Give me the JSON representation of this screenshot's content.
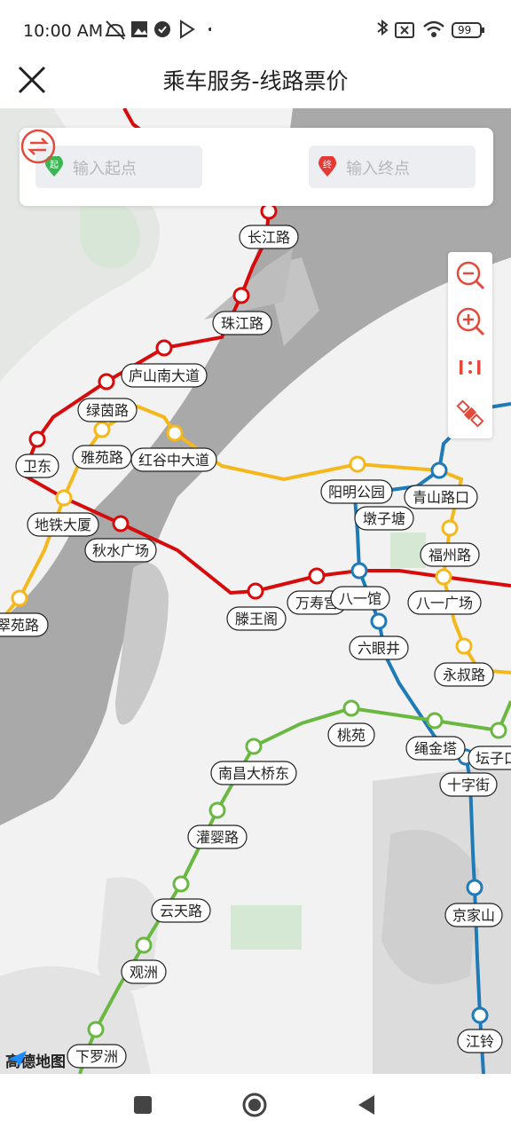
{
  "status_bar": {
    "time": "10:00 AM",
    "battery": "99"
  },
  "header": {
    "title": "乘车服务-线路票价"
  },
  "search": {
    "start_tag": "起",
    "end_tag": "终",
    "start_placeholder": "输入起点",
    "end_placeholder": "输入终点"
  },
  "map_controls": [
    "zoom-out",
    "zoom-in",
    "ratio-1-1",
    "satellite"
  ],
  "brand": {
    "logo_text": "高德地图"
  },
  "colors": {
    "line1_red": "#d60b0b",
    "line2_yellow": "#f5b81c",
    "line3_blue": "#1f7ab8",
    "line4_green": "#6ab842",
    "start_pin": "#3cb554",
    "end_pin": "#e53935",
    "accent": "#e24a3b"
  },
  "stations": {
    "changjiang": "长江路",
    "zhujiang": "珠江路",
    "lushan": "庐山南大道",
    "lvyin": "绿茵路",
    "weidong": "卫东",
    "yayuan": "雅苑路",
    "honggu": "红谷中大道",
    "ditie": "地铁大厦",
    "qiushui": "秋水广场",
    "cuiyuan": "翠苑路",
    "tengwang": "滕王阁",
    "wanshou": "万寿宫",
    "bayiguan": "八一馆",
    "yangming": "阳明公园",
    "qingshan": "青山路口",
    "dunzi": "墩子塘",
    "fuzhou": "福州路",
    "bayiguangchang": "八一广场",
    "liuyan": "六眼井",
    "yongshu": "永叔路",
    "taoyuan": "桃苑",
    "shengjin": "绳金塔",
    "tanzi": "坛子口",
    "shizi": "十字街",
    "nanchang": "南昌大桥东",
    "guanying": "灌婴路",
    "yuntian": "云天路",
    "guanzhou": "观洲",
    "jingjia": "京家山",
    "jiangling": "江铃",
    "xiafang": "下罗洲"
  }
}
